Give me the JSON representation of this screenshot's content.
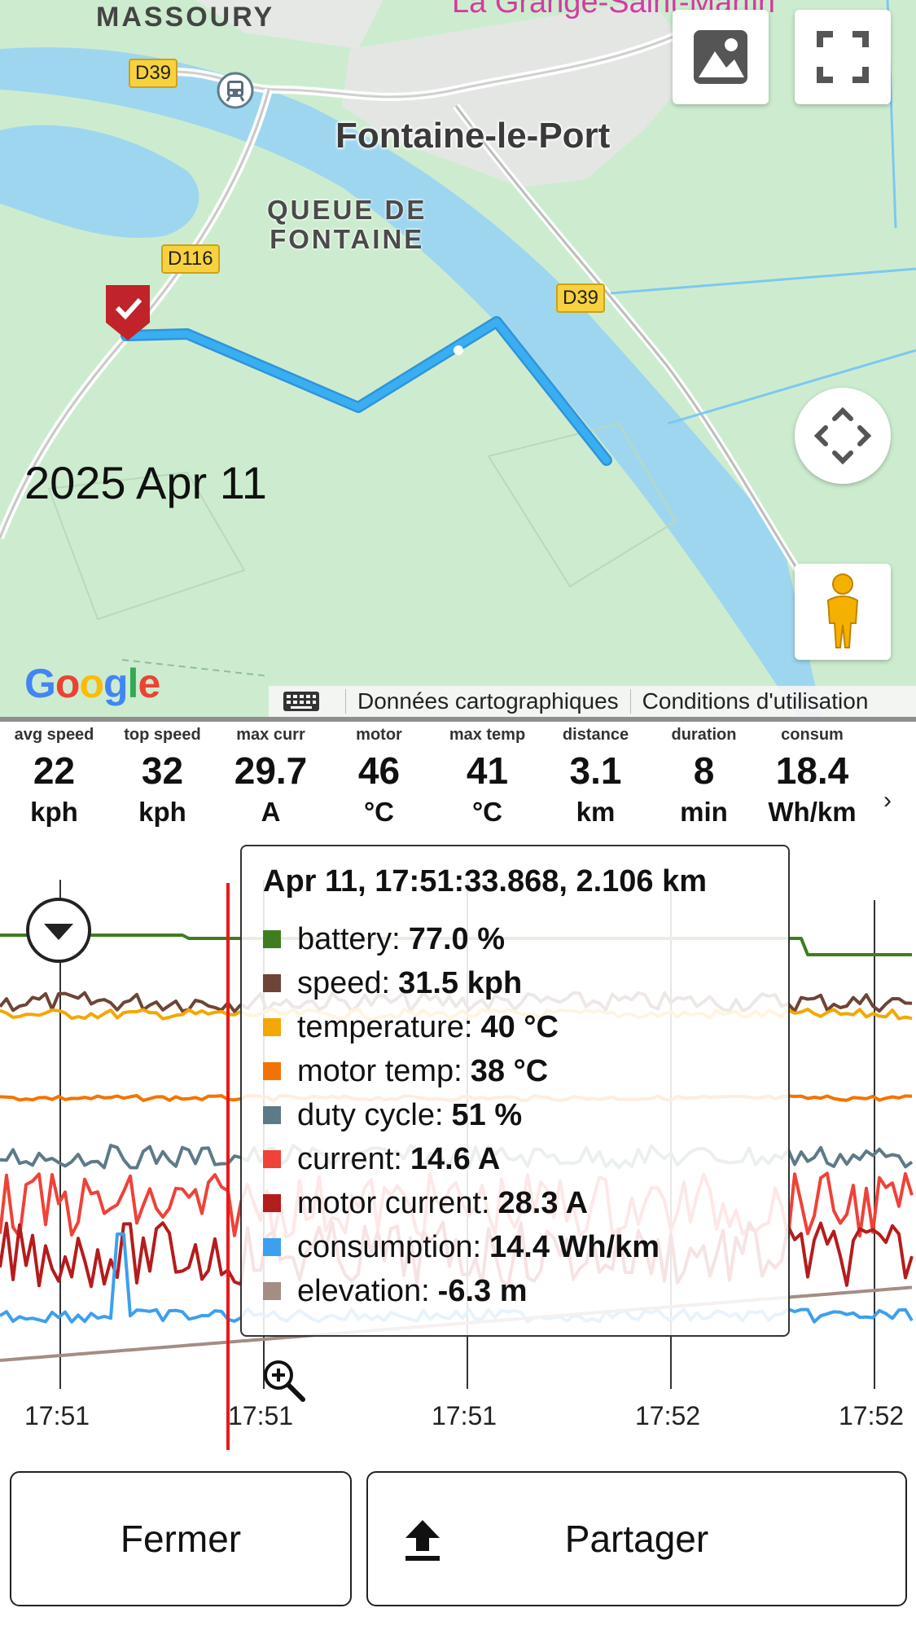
{
  "map": {
    "top_label": "MASSOURY",
    "top_right_label": "La Grange-Saint-Martin",
    "town": "Fontaine-le-Port",
    "area_line1": "QUEUE DE",
    "area_line2": "FONTAINE",
    "roads": [
      "D39",
      "D116",
      "D39"
    ],
    "date": "2025 Apr 11",
    "google": [
      "G",
      "o",
      "o",
      "g",
      "l",
      "e"
    ],
    "google_colors": [
      "#4285F4",
      "#EA4335",
      "#FBBC05",
      "#4285F4",
      "#34A853",
      "#EA4335"
    ],
    "attribution_data": "Données cartographiques",
    "attribution_terms": "Conditions d'utilisation",
    "route_color": "#3aaef3",
    "start_marker_color": "#c0242a"
  },
  "stats": [
    {
      "label": "avg speed",
      "value": "22",
      "unit": "kph"
    },
    {
      "label": "top speed",
      "value": "32",
      "unit": "kph"
    },
    {
      "label": "max curr",
      "value": "29.7",
      "unit": "A"
    },
    {
      "label": "motor",
      "value": "46",
      "unit": "°C"
    },
    {
      "label": "max temp",
      "value": "41",
      "unit": "°C"
    },
    {
      "label": "distance",
      "value": "3.1",
      "unit": "km"
    },
    {
      "label": "duration",
      "value": "8",
      "unit": "min"
    },
    {
      "label": "consum",
      "value": "18.4",
      "unit": "Wh/km"
    }
  ],
  "stats_more": "›",
  "tooltip": {
    "header": "Apr 11, 17:51:33.868, 2.106 km",
    "rows": [
      {
        "name": "battery:",
        "value": "77.0 %",
        "color": "#3f7d1e"
      },
      {
        "name": "speed:",
        "value": "31.5 kph",
        "color": "#6d4437"
      },
      {
        "name": "temperature:",
        "value": "40 °C",
        "color": "#f4a700"
      },
      {
        "name": "motor temp:",
        "value": "38 °C",
        "color": "#f47300"
      },
      {
        "name": "duty cycle:",
        "value": "51 %",
        "color": "#5e7a87"
      },
      {
        "name": "current:",
        "value": "14.6 A",
        "color": "#ef4238"
      },
      {
        "name": "motor current:",
        "value": "28.3 A",
        "color": "#b51c1c"
      },
      {
        "name": "consumption:",
        "value": "14.4 Wh/km",
        "color": "#3d9fef"
      },
      {
        "name": "elevation:",
        "value": "-6.3 m",
        "color": "#a38d85"
      }
    ]
  },
  "chart_data": {
    "type": "line",
    "x_tick_labels": [
      "17:51",
      "17:51",
      "17:51",
      "17:52",
      "17:52"
    ],
    "series": [
      {
        "name": "battery",
        "color": "#3f7d1e"
      },
      {
        "name": "speed",
        "color": "#6d4437"
      },
      {
        "name": "temperature",
        "color": "#f4a700"
      },
      {
        "name": "motor temp",
        "color": "#f47300"
      },
      {
        "name": "duty cycle",
        "color": "#5e7a87"
      },
      {
        "name": "current",
        "color": "#ef4238"
      },
      {
        "name": "motor current",
        "color": "#b51c1c"
      },
      {
        "name": "consumption",
        "color": "#3d9fef"
      },
      {
        "name": "elevation",
        "color": "#a38d85"
      }
    ],
    "cursor_color": "#e81919",
    "grid": true
  },
  "buttons": {
    "close": "Fermer",
    "share": "Partager"
  }
}
